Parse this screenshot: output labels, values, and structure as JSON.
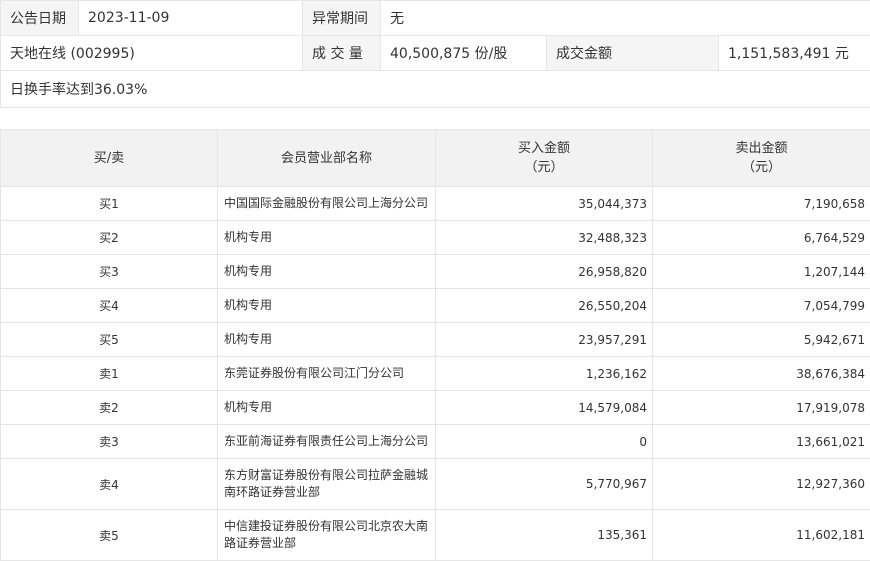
{
  "summary": {
    "date_label": "公告日期",
    "date_value": "2023-11-09",
    "period_label": "异常期间",
    "period_value": "无",
    "stock": "天地在线 (002995)",
    "volume_label": "成 交 量",
    "volume_value": "40,500,875 份/股",
    "amount_label": "成交金额",
    "amount_value": "1,151,583,491 元",
    "reason": "日换手率达到36.03%"
  },
  "table": {
    "headers": {
      "side": "买/卖",
      "branch": "会员营业部名称",
      "buy_line1": "买入金额",
      "buy_line2": "（元）",
      "sell_line1": "卖出金额",
      "sell_line2": "（元）"
    },
    "rows": [
      {
        "side": "买1",
        "branch": "中国国际金融股份有限公司上海分公司",
        "buy": "35,044,373",
        "sell": "7,190,658"
      },
      {
        "side": "买2",
        "branch": "机构专用",
        "buy": "32,488,323",
        "sell": "6,764,529"
      },
      {
        "side": "买3",
        "branch": "机构专用",
        "buy": "26,958,820",
        "sell": "1,207,144"
      },
      {
        "side": "买4",
        "branch": "机构专用",
        "buy": "26,550,204",
        "sell": "7,054,799"
      },
      {
        "side": "买5",
        "branch": "机构专用",
        "buy": "23,957,291",
        "sell": "5,942,671"
      },
      {
        "side": "卖1",
        "branch": "东莞证券股份有限公司江门分公司",
        "buy": "1,236,162",
        "sell": "38,676,384"
      },
      {
        "side": "卖2",
        "branch": "机构专用",
        "buy": "14,579,084",
        "sell": "17,919,078"
      },
      {
        "side": "卖3",
        "branch": "东亚前海证券有限责任公司上海分公司",
        "buy": "0",
        "sell": "13,661,021"
      },
      {
        "side": "卖4",
        "branch": "东方财富证券股份有限公司拉萨金融城南环路证券营业部",
        "buy": "5,770,967",
        "sell": "12,927,360"
      },
      {
        "side": "卖5",
        "branch": "中信建投证券股份有限公司北京农大南路证券营业部",
        "buy": "135,361",
        "sell": "11,602,181"
      }
    ]
  }
}
